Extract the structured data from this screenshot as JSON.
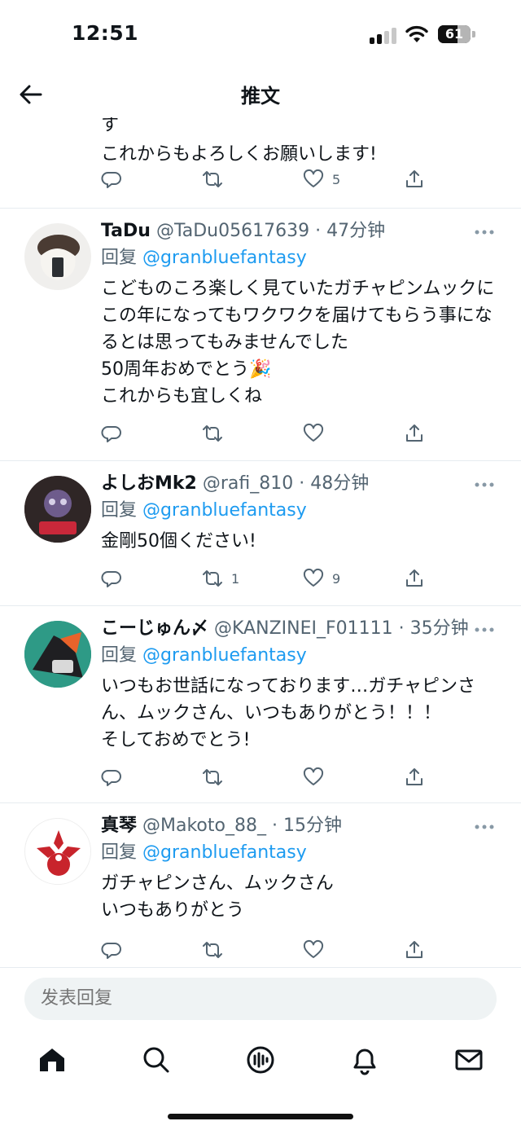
{
  "status_bar": {
    "time": "12:51",
    "battery": "61",
    "battery_level": 0.61
  },
  "header": {
    "title": "推文"
  },
  "tweets": [
    {
      "text": "す\nこれからもよろしくお願いします!",
      "stats": {
        "replies": "",
        "retweets": "",
        "likes": "5"
      }
    },
    {
      "name": "TaDu",
      "handle": "@TaDu05617639",
      "time": "47分钟",
      "reply_prefix": "回复",
      "reply_to": "@granbluefantasy",
      "text": "こどものころ楽しく見ていたガチャピンムックにこの年になってもワクワクを届けてもらう事になるとは思ってもみませんでした\n50周年おめでとう🎉\nこれからも宜しくね",
      "stats": {
        "replies": "",
        "retweets": "",
        "likes": ""
      }
    },
    {
      "name": "よしおMk2",
      "handle": "@rafi_810",
      "time": "48分钟",
      "reply_prefix": "回复",
      "reply_to": "@granbluefantasy",
      "text": "金剛50個ください!",
      "stats": {
        "replies": "",
        "retweets": "1",
        "likes": "9"
      }
    },
    {
      "name": "こーじゅん〆",
      "handle": "@KANZINEI_F01111",
      "time": "35分钟",
      "reply_prefix": "回复",
      "reply_to": "@granbluefantasy",
      "text": "いつもお世話になっております…ガチャピンさん、ムックさん、いつもありがとう！！！\nそしておめでとう!",
      "stats": {
        "replies": "",
        "retweets": "",
        "likes": ""
      }
    },
    {
      "name": "真琴",
      "handle": "@Makoto_88_",
      "time": "15分钟",
      "reply_prefix": "回复",
      "reply_to": "@granbluefantasy",
      "text": "ガチャピンさん、ムックさん\nいつもありがとう",
      "stats": {
        "replies": "",
        "retweets": "",
        "likes": ""
      }
    }
  ],
  "reply_bar": {
    "placeholder": "发表回复"
  },
  "tabbar": {
    "items": [
      "home-icon",
      "search-icon",
      "spaces-icon",
      "notifications-icon",
      "messages-icon"
    ]
  },
  "colors": {
    "accent": "#1d9bf0",
    "secondary_text": "#536471",
    "divider": "#e6ecf0"
  }
}
